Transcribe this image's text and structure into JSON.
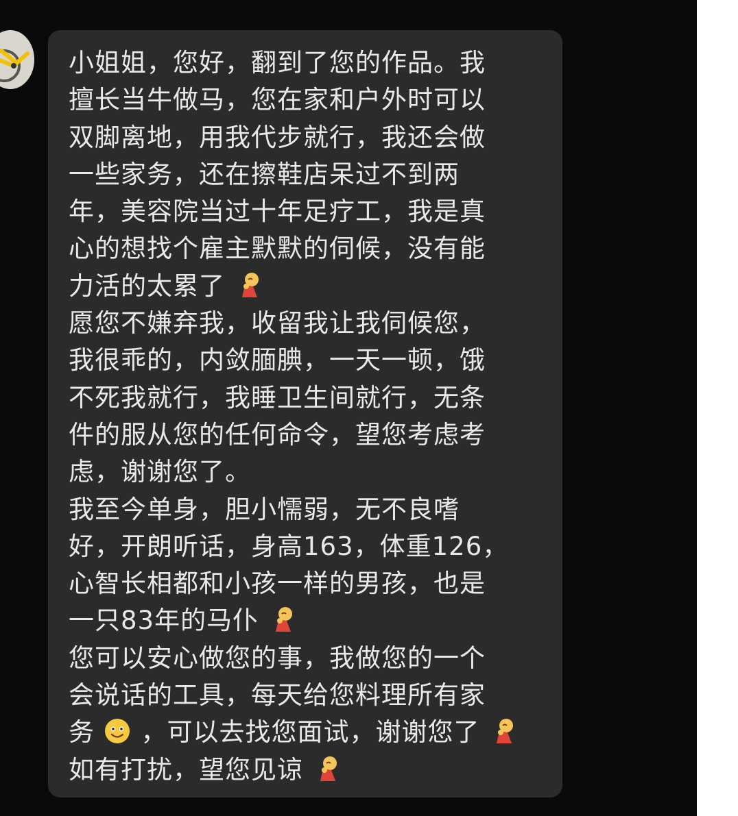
{
  "colors": {
    "background": "#0a0a0a",
    "bubble": "#2b2b2b",
    "text": "#e9e9e9",
    "right_strip": "#ffffff"
  },
  "avatar": {
    "icon": "bicycle-avatar-icon"
  },
  "message": {
    "lines": [
      "小姐姐，您好，翻到了您的作品。我",
      "擅长当牛做马，您在家和户外时可以",
      "双脚离地，用我代步就行，我还会做",
      "一些家务，还在擦鞋店呆过不到两",
      "年，美容院当过十年足疗工，我是真",
      "心的想找个雇主默默的伺候，没有能",
      "力活的太累了",
      "愿您不嫌弃我，收留我让我伺候您，",
      "我很乖的，内敛腼腆，一天一顿，饿",
      "不死我就行，我睡卫生间就行，无条",
      "件的服从您的任何命令，望您考虑考",
      "虑，谢谢您了。",
      "我至今单身，胆小懦弱，无不良嗜",
      "好，开朗听话，身高163，体重126，",
      "心智长相都和小孩一样的男孩，也是",
      "一只83年的马仆",
      "您可以安心做您的事，我做您的一个",
      "会说话的工具，每天给您料理所有家",
      "务",
      "，可以去找您面试，谢谢您了",
      "如有打扰，望您见谅"
    ],
    "emoji_names": {
      "pleading": "person-bowing-emoji",
      "smile": "smiling-face-emoji"
    }
  }
}
